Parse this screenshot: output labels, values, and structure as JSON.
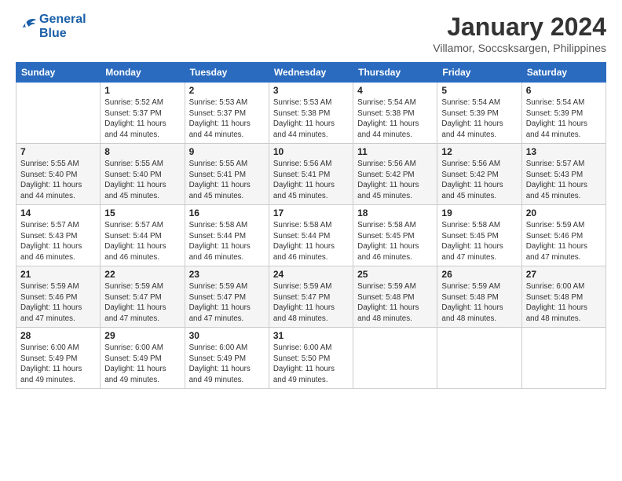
{
  "logo": {
    "line1": "General",
    "line2": "Blue"
  },
  "title": "January 2024",
  "subtitle": "Villamor, Soccsksargen, Philippines",
  "days_header": [
    "Sunday",
    "Monday",
    "Tuesday",
    "Wednesday",
    "Thursday",
    "Friday",
    "Saturday"
  ],
  "weeks": [
    [
      {
        "num": "",
        "info": ""
      },
      {
        "num": "1",
        "info": "Sunrise: 5:52 AM\nSunset: 5:37 PM\nDaylight: 11 hours\nand 44 minutes."
      },
      {
        "num": "2",
        "info": "Sunrise: 5:53 AM\nSunset: 5:37 PM\nDaylight: 11 hours\nand 44 minutes."
      },
      {
        "num": "3",
        "info": "Sunrise: 5:53 AM\nSunset: 5:38 PM\nDaylight: 11 hours\nand 44 minutes."
      },
      {
        "num": "4",
        "info": "Sunrise: 5:54 AM\nSunset: 5:38 PM\nDaylight: 11 hours\nand 44 minutes."
      },
      {
        "num": "5",
        "info": "Sunrise: 5:54 AM\nSunset: 5:39 PM\nDaylight: 11 hours\nand 44 minutes."
      },
      {
        "num": "6",
        "info": "Sunrise: 5:54 AM\nSunset: 5:39 PM\nDaylight: 11 hours\nand 44 minutes."
      }
    ],
    [
      {
        "num": "7",
        "info": "Sunrise: 5:55 AM\nSunset: 5:40 PM\nDaylight: 11 hours\nand 44 minutes."
      },
      {
        "num": "8",
        "info": "Sunrise: 5:55 AM\nSunset: 5:40 PM\nDaylight: 11 hours\nand 45 minutes."
      },
      {
        "num": "9",
        "info": "Sunrise: 5:55 AM\nSunset: 5:41 PM\nDaylight: 11 hours\nand 45 minutes."
      },
      {
        "num": "10",
        "info": "Sunrise: 5:56 AM\nSunset: 5:41 PM\nDaylight: 11 hours\nand 45 minutes."
      },
      {
        "num": "11",
        "info": "Sunrise: 5:56 AM\nSunset: 5:42 PM\nDaylight: 11 hours\nand 45 minutes."
      },
      {
        "num": "12",
        "info": "Sunrise: 5:56 AM\nSunset: 5:42 PM\nDaylight: 11 hours\nand 45 minutes."
      },
      {
        "num": "13",
        "info": "Sunrise: 5:57 AM\nSunset: 5:43 PM\nDaylight: 11 hours\nand 45 minutes."
      }
    ],
    [
      {
        "num": "14",
        "info": "Sunrise: 5:57 AM\nSunset: 5:43 PM\nDaylight: 11 hours\nand 46 minutes."
      },
      {
        "num": "15",
        "info": "Sunrise: 5:57 AM\nSunset: 5:44 PM\nDaylight: 11 hours\nand 46 minutes."
      },
      {
        "num": "16",
        "info": "Sunrise: 5:58 AM\nSunset: 5:44 PM\nDaylight: 11 hours\nand 46 minutes."
      },
      {
        "num": "17",
        "info": "Sunrise: 5:58 AM\nSunset: 5:44 PM\nDaylight: 11 hours\nand 46 minutes."
      },
      {
        "num": "18",
        "info": "Sunrise: 5:58 AM\nSunset: 5:45 PM\nDaylight: 11 hours\nand 46 minutes."
      },
      {
        "num": "19",
        "info": "Sunrise: 5:58 AM\nSunset: 5:45 PM\nDaylight: 11 hours\nand 47 minutes."
      },
      {
        "num": "20",
        "info": "Sunrise: 5:59 AM\nSunset: 5:46 PM\nDaylight: 11 hours\nand 47 minutes."
      }
    ],
    [
      {
        "num": "21",
        "info": "Sunrise: 5:59 AM\nSunset: 5:46 PM\nDaylight: 11 hours\nand 47 minutes."
      },
      {
        "num": "22",
        "info": "Sunrise: 5:59 AM\nSunset: 5:47 PM\nDaylight: 11 hours\nand 47 minutes."
      },
      {
        "num": "23",
        "info": "Sunrise: 5:59 AM\nSunset: 5:47 PM\nDaylight: 11 hours\nand 47 minutes."
      },
      {
        "num": "24",
        "info": "Sunrise: 5:59 AM\nSunset: 5:47 PM\nDaylight: 11 hours\nand 48 minutes."
      },
      {
        "num": "25",
        "info": "Sunrise: 5:59 AM\nSunset: 5:48 PM\nDaylight: 11 hours\nand 48 minutes."
      },
      {
        "num": "26",
        "info": "Sunrise: 5:59 AM\nSunset: 5:48 PM\nDaylight: 11 hours\nand 48 minutes."
      },
      {
        "num": "27",
        "info": "Sunrise: 6:00 AM\nSunset: 5:48 PM\nDaylight: 11 hours\nand 48 minutes."
      }
    ],
    [
      {
        "num": "28",
        "info": "Sunrise: 6:00 AM\nSunset: 5:49 PM\nDaylight: 11 hours\nand 49 minutes."
      },
      {
        "num": "29",
        "info": "Sunrise: 6:00 AM\nSunset: 5:49 PM\nDaylight: 11 hours\nand 49 minutes."
      },
      {
        "num": "30",
        "info": "Sunrise: 6:00 AM\nSunset: 5:49 PM\nDaylight: 11 hours\nand 49 minutes."
      },
      {
        "num": "31",
        "info": "Sunrise: 6:00 AM\nSunset: 5:50 PM\nDaylight: 11 hours\nand 49 minutes."
      },
      {
        "num": "",
        "info": ""
      },
      {
        "num": "",
        "info": ""
      },
      {
        "num": "",
        "info": ""
      }
    ]
  ]
}
